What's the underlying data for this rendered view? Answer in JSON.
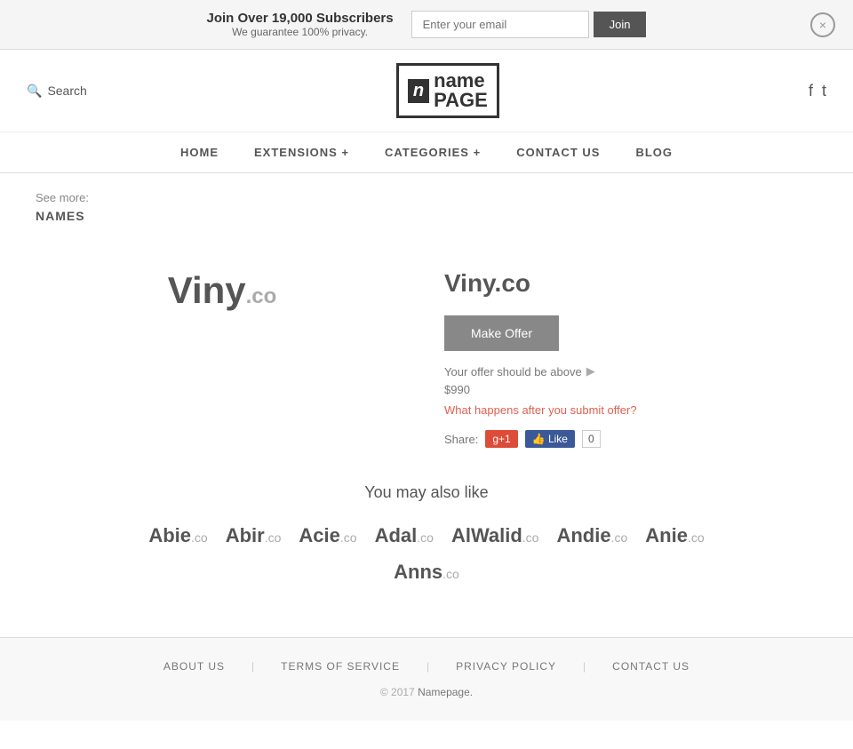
{
  "banner": {
    "title": "Join Over 19,000 Subscribers",
    "subtitle": "We guarantee 100% privacy.",
    "email_placeholder": "Enter your email",
    "join_label": "Join",
    "close_label": "×"
  },
  "header": {
    "search_label": "Search",
    "logo_n": "n",
    "logo_name": "name",
    "logo_page": "PAGE",
    "facebook_icon": "f",
    "twitter_icon": "t"
  },
  "nav": {
    "items": [
      {
        "label": "HOME",
        "id": "home"
      },
      {
        "label": "EXTENSIONS +",
        "id": "extensions"
      },
      {
        "label": "CATEGORIES +",
        "id": "categories"
      },
      {
        "label": "CONTACT US",
        "id": "contact"
      },
      {
        "label": "BLOG",
        "id": "blog"
      }
    ]
  },
  "breadcrumb": {
    "see_more_label": "See more:",
    "names_label": "NAMES"
  },
  "domain": {
    "preview_name": "Viny",
    "preview_suffix": ".co",
    "full_name": "Viny.co",
    "make_offer_label": "Make Offer",
    "offer_note": "Your offer should be above",
    "offer_price": "$990",
    "what_happens_label": "What happens after you submit offer?",
    "share_label": "Share:",
    "gplus_label": "g+1",
    "fb_label": "👍 Like",
    "fb_count": "0"
  },
  "similar": {
    "title": "You may also like",
    "row1": [
      {
        "name": "Abie",
        "suffix": ".co"
      },
      {
        "name": "Abir",
        "suffix": ".co"
      },
      {
        "name": "Acie",
        "suffix": ".co"
      },
      {
        "name": "Adal",
        "suffix": ".co"
      },
      {
        "name": "AlWalid",
        "suffix": ".co"
      },
      {
        "name": "Andie",
        "suffix": ".co"
      },
      {
        "name": "Anie",
        "suffix": ".co"
      }
    ],
    "row2": [
      {
        "name": "Anns",
        "suffix": ".co"
      }
    ]
  },
  "footer": {
    "links": [
      {
        "label": "ABOUT US",
        "id": "about-us"
      },
      {
        "label": "TERMS OF SERVICE",
        "id": "terms"
      },
      {
        "label": "PRIVACY POLICY",
        "id": "privacy"
      },
      {
        "label": "CONTACT US",
        "id": "contact-us"
      }
    ],
    "copyright": "© 2017",
    "brand": "Namepage.",
    "dividers": [
      "|",
      "|",
      "|"
    ]
  }
}
